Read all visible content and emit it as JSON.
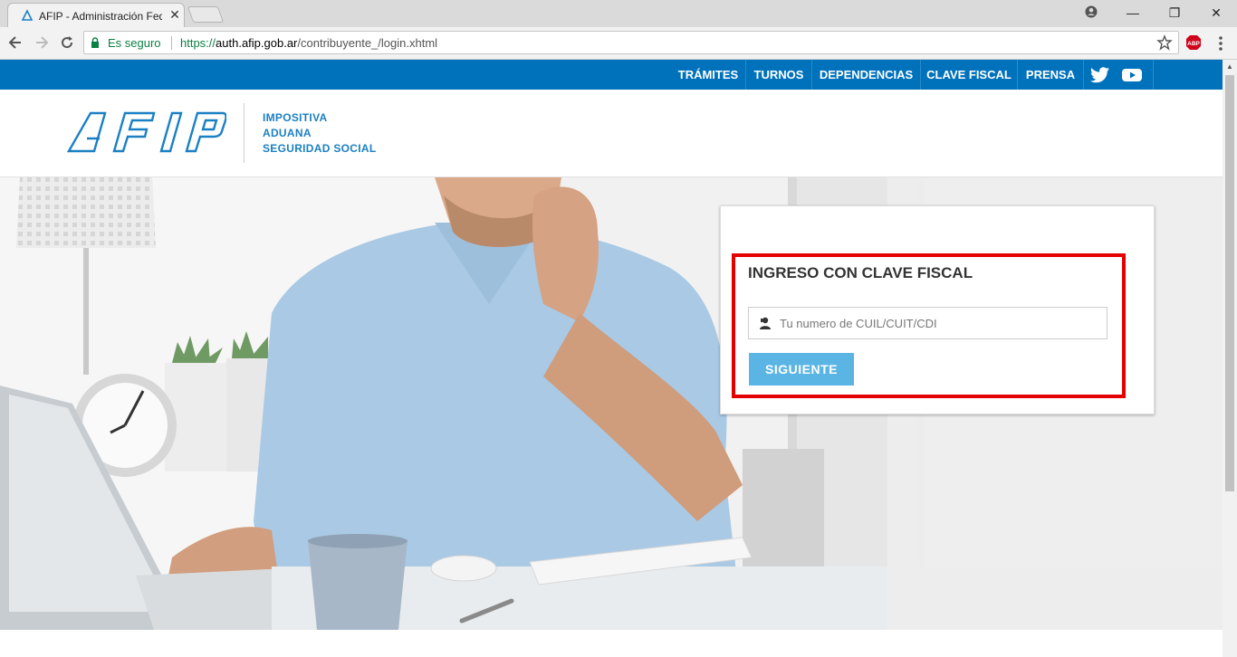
{
  "browser": {
    "tab_title": "AFIP - Administración Fed",
    "tab_close": "✕",
    "secure_label": "Es seguro",
    "url_scheme": "https://",
    "url_host": "auth.afip.gob.ar",
    "url_path": "/contribuyente_/login.xhtml",
    "window_controls": {
      "minimize": "—",
      "restore": "❐",
      "close": "✕"
    }
  },
  "topnav": {
    "items": [
      "TRÁMITES",
      "TURNOS",
      "DEPENDENCIAS",
      "CLAVE FISCAL",
      "PRENSA"
    ],
    "social": [
      "twitter-icon",
      "youtube-icon"
    ],
    "color": "#0072bb"
  },
  "header": {
    "logo_text": "AFIP",
    "taglines": [
      "IMPOSITIVA",
      "ADUANA",
      "SEGURIDAD SOCIAL"
    ],
    "tagline_color": "#1b80c3"
  },
  "login": {
    "title": "INGRESO CON CLAVE FISCAL",
    "cuil_placeholder": "Tu numero de CUIL/CUIT/CDI",
    "cuil_value": "",
    "submit_label": "SIGUIENTE",
    "submit_color": "#5bb5e4",
    "highlight_color": "#e50000"
  }
}
